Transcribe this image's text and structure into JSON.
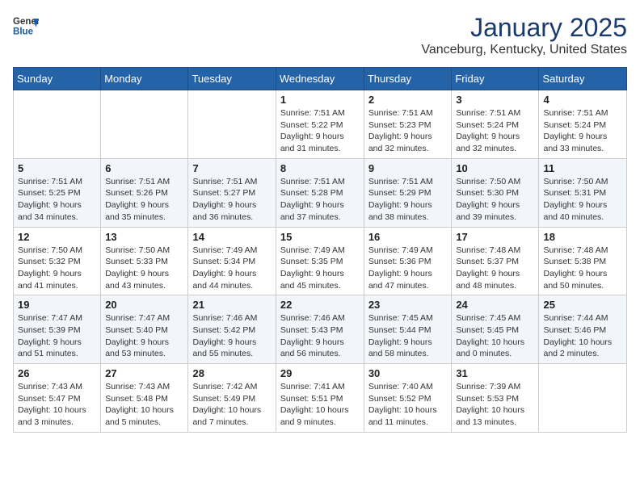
{
  "header": {
    "logo_general": "General",
    "logo_blue": "Blue",
    "month": "January 2025",
    "location": "Vanceburg, Kentucky, United States"
  },
  "days_of_week": [
    "Sunday",
    "Monday",
    "Tuesday",
    "Wednesday",
    "Thursday",
    "Friday",
    "Saturday"
  ],
  "weeks": [
    [
      {
        "day": "",
        "info": ""
      },
      {
        "day": "",
        "info": ""
      },
      {
        "day": "",
        "info": ""
      },
      {
        "day": "1",
        "info": "Sunrise: 7:51 AM\nSunset: 5:22 PM\nDaylight: 9 hours and 31 minutes."
      },
      {
        "day": "2",
        "info": "Sunrise: 7:51 AM\nSunset: 5:23 PM\nDaylight: 9 hours and 32 minutes."
      },
      {
        "day": "3",
        "info": "Sunrise: 7:51 AM\nSunset: 5:24 PM\nDaylight: 9 hours and 32 minutes."
      },
      {
        "day": "4",
        "info": "Sunrise: 7:51 AM\nSunset: 5:24 PM\nDaylight: 9 hours and 33 minutes."
      }
    ],
    [
      {
        "day": "5",
        "info": "Sunrise: 7:51 AM\nSunset: 5:25 PM\nDaylight: 9 hours and 34 minutes."
      },
      {
        "day": "6",
        "info": "Sunrise: 7:51 AM\nSunset: 5:26 PM\nDaylight: 9 hours and 35 minutes."
      },
      {
        "day": "7",
        "info": "Sunrise: 7:51 AM\nSunset: 5:27 PM\nDaylight: 9 hours and 36 minutes."
      },
      {
        "day": "8",
        "info": "Sunrise: 7:51 AM\nSunset: 5:28 PM\nDaylight: 9 hours and 37 minutes."
      },
      {
        "day": "9",
        "info": "Sunrise: 7:51 AM\nSunset: 5:29 PM\nDaylight: 9 hours and 38 minutes."
      },
      {
        "day": "10",
        "info": "Sunrise: 7:50 AM\nSunset: 5:30 PM\nDaylight: 9 hours and 39 minutes."
      },
      {
        "day": "11",
        "info": "Sunrise: 7:50 AM\nSunset: 5:31 PM\nDaylight: 9 hours and 40 minutes."
      }
    ],
    [
      {
        "day": "12",
        "info": "Sunrise: 7:50 AM\nSunset: 5:32 PM\nDaylight: 9 hours and 41 minutes."
      },
      {
        "day": "13",
        "info": "Sunrise: 7:50 AM\nSunset: 5:33 PM\nDaylight: 9 hours and 43 minutes."
      },
      {
        "day": "14",
        "info": "Sunrise: 7:49 AM\nSunset: 5:34 PM\nDaylight: 9 hours and 44 minutes."
      },
      {
        "day": "15",
        "info": "Sunrise: 7:49 AM\nSunset: 5:35 PM\nDaylight: 9 hours and 45 minutes."
      },
      {
        "day": "16",
        "info": "Sunrise: 7:49 AM\nSunset: 5:36 PM\nDaylight: 9 hours and 47 minutes."
      },
      {
        "day": "17",
        "info": "Sunrise: 7:48 AM\nSunset: 5:37 PM\nDaylight: 9 hours and 48 minutes."
      },
      {
        "day": "18",
        "info": "Sunrise: 7:48 AM\nSunset: 5:38 PM\nDaylight: 9 hours and 50 minutes."
      }
    ],
    [
      {
        "day": "19",
        "info": "Sunrise: 7:47 AM\nSunset: 5:39 PM\nDaylight: 9 hours and 51 minutes."
      },
      {
        "day": "20",
        "info": "Sunrise: 7:47 AM\nSunset: 5:40 PM\nDaylight: 9 hours and 53 minutes."
      },
      {
        "day": "21",
        "info": "Sunrise: 7:46 AM\nSunset: 5:42 PM\nDaylight: 9 hours and 55 minutes."
      },
      {
        "day": "22",
        "info": "Sunrise: 7:46 AM\nSunset: 5:43 PM\nDaylight: 9 hours and 56 minutes."
      },
      {
        "day": "23",
        "info": "Sunrise: 7:45 AM\nSunset: 5:44 PM\nDaylight: 9 hours and 58 minutes."
      },
      {
        "day": "24",
        "info": "Sunrise: 7:45 AM\nSunset: 5:45 PM\nDaylight: 10 hours and 0 minutes."
      },
      {
        "day": "25",
        "info": "Sunrise: 7:44 AM\nSunset: 5:46 PM\nDaylight: 10 hours and 2 minutes."
      }
    ],
    [
      {
        "day": "26",
        "info": "Sunrise: 7:43 AM\nSunset: 5:47 PM\nDaylight: 10 hours and 3 minutes."
      },
      {
        "day": "27",
        "info": "Sunrise: 7:43 AM\nSunset: 5:48 PM\nDaylight: 10 hours and 5 minutes."
      },
      {
        "day": "28",
        "info": "Sunrise: 7:42 AM\nSunset: 5:49 PM\nDaylight: 10 hours and 7 minutes."
      },
      {
        "day": "29",
        "info": "Sunrise: 7:41 AM\nSunset: 5:51 PM\nDaylight: 10 hours and 9 minutes."
      },
      {
        "day": "30",
        "info": "Sunrise: 7:40 AM\nSunset: 5:52 PM\nDaylight: 10 hours and 11 minutes."
      },
      {
        "day": "31",
        "info": "Sunrise: 7:39 AM\nSunset: 5:53 PM\nDaylight: 10 hours and 13 minutes."
      },
      {
        "day": "",
        "info": ""
      }
    ]
  ]
}
